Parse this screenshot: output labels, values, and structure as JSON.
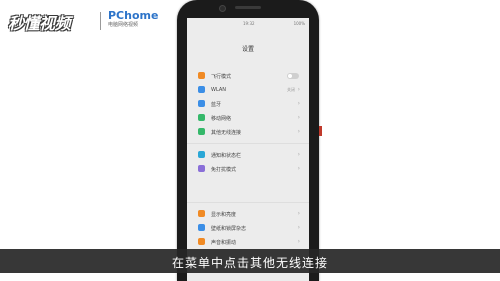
{
  "watermark": {
    "logo_text": "秒懂视频",
    "brand_name": "PChome",
    "brand_sub": "电脑网络视频"
  },
  "status_bar": {
    "time": "19:32",
    "right": "100%"
  },
  "settings": {
    "title": "设置",
    "items": [
      {
        "label": "飞行模式",
        "icon_color": "#f08a24",
        "control": "toggle",
        "toggle_on": false
      },
      {
        "label": "WLAN",
        "icon_color": "#3b8ee6",
        "control": "chevron",
        "value": "关闭"
      },
      {
        "label": "蓝牙",
        "icon_color": "#3b8ee6",
        "control": "chevron"
      },
      {
        "label": "移动网络",
        "icon_color": "#35b86a",
        "control": "chevron"
      },
      {
        "label": "其他无线连接",
        "icon_color": "#35b86a",
        "control": "chevron"
      },
      {
        "label": "通知和状态栏",
        "icon_color": "#2aa7d6",
        "control": "chevron"
      },
      {
        "label": "免打扰模式",
        "icon_color": "#8a6fd8",
        "control": "chevron"
      },
      {
        "label": "显示和亮度",
        "icon_color": "#f08a24",
        "control": "chevron"
      },
      {
        "label": "壁纸和锁屏杂志",
        "icon_color": "#3b8ee6",
        "control": "chevron"
      },
      {
        "label": "声音和振动",
        "icon_color": "#f08a24",
        "control": "chevron"
      }
    ]
  },
  "subtitle": "在菜单中点击其他无线连接"
}
